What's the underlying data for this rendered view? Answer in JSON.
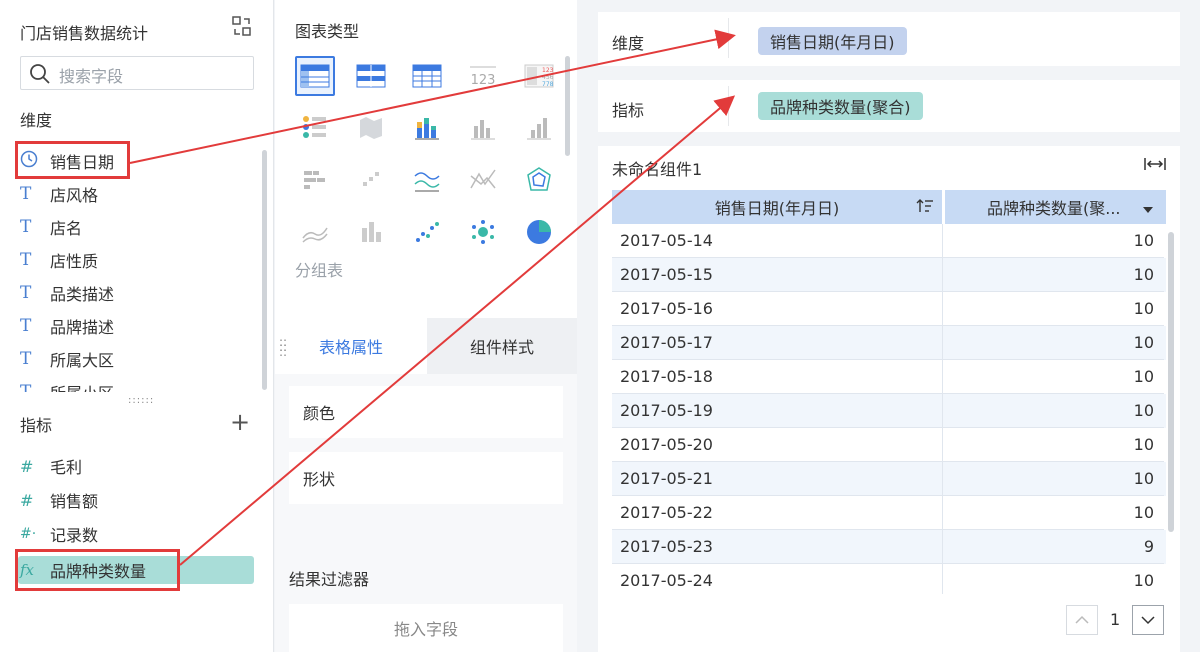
{
  "left_panel": {
    "dataset_title": "门店销售数据统计",
    "search_placeholder": "搜索字段",
    "dimensions_title": "维度",
    "dimensions": [
      {
        "icon": "clock-icon",
        "label": "销售日期"
      },
      {
        "icon": "text-field-icon",
        "label": "店风格"
      },
      {
        "icon": "text-field-icon",
        "label": "店名"
      },
      {
        "icon": "text-field-icon",
        "label": "店性质"
      },
      {
        "icon": "text-field-icon",
        "label": "品类描述"
      },
      {
        "icon": "text-field-icon",
        "label": "品牌描述"
      },
      {
        "icon": "text-field-icon",
        "label": "所属大区"
      },
      {
        "icon": "text-field-icon",
        "label": "所属小区"
      }
    ],
    "measures_title": "指标",
    "measures": [
      {
        "icon": "number-field-icon",
        "label": "毛利"
      },
      {
        "icon": "number-field-icon",
        "label": "销售额"
      },
      {
        "icon": "record-count-icon",
        "label": "记录数"
      },
      {
        "icon": "formula-icon",
        "label": "品牌种类数量"
      }
    ],
    "field_type_glyphs": {
      "text": "T",
      "number": "#",
      "record": "#·",
      "formula": "fx",
      "clock": "◷"
    }
  },
  "middle_panel": {
    "chart_types_title": "图表类型",
    "group_table_label": "分组表",
    "tabs": [
      "表格属性",
      "组件样式"
    ],
    "properties": [
      "颜色",
      "形状"
    ],
    "filter_title": "结果过滤器",
    "filter_drop_hint": "拖入字段",
    "mini_number_text": "123",
    "mini_crosstable_values": [
      "123",
      "456",
      "778"
    ]
  },
  "right_panel": {
    "dimension_label": "维度",
    "dimension_pill": "销售日期(年月日)",
    "measure_label": "指标",
    "measure_pill": "品牌种类数量(聚合)",
    "widget_title": "未命名组件1",
    "table": {
      "columns": [
        "销售日期(年月日)",
        "品牌种类数量(聚..."
      ],
      "rows": [
        [
          "2017-05-14",
          "10"
        ],
        [
          "2017-05-15",
          "10"
        ],
        [
          "2017-05-16",
          "10"
        ],
        [
          "2017-05-17",
          "10"
        ],
        [
          "2017-05-18",
          "10"
        ],
        [
          "2017-05-19",
          "10"
        ],
        [
          "2017-05-20",
          "10"
        ],
        [
          "2017-05-21",
          "10"
        ],
        [
          "2017-05-22",
          "10"
        ],
        [
          "2017-05-23",
          "9"
        ],
        [
          "2017-05-24",
          "10"
        ]
      ]
    },
    "pagination": {
      "current_page": "1"
    }
  },
  "colors": {
    "accent_blue": "#3c7ae0",
    "dimension_pill": "#c3d2ee",
    "measure_pill": "#a9ddd8",
    "annotation_red": "#e23b3b",
    "header_blue": "#c7daf4"
  }
}
